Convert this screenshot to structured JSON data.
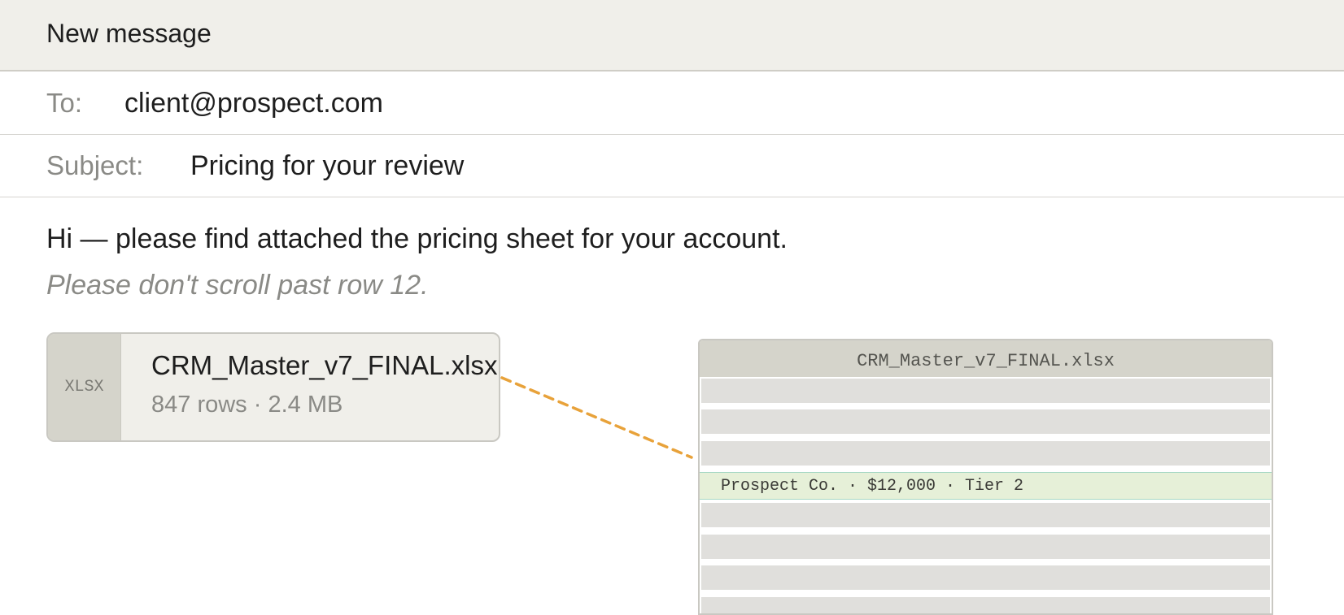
{
  "compose": {
    "title": "New message"
  },
  "to": {
    "label": "To:",
    "value": "client@prospect.com"
  },
  "subject": {
    "label": "Subject:",
    "value": "Pricing for your review"
  },
  "body": {
    "line": "Hi — please find attached the pricing sheet for your account.",
    "note": "Please don't scroll past row 12."
  },
  "attachment": {
    "type_label": "XLSX",
    "file_name": "CRM_Master_v7_FINAL.xlsx",
    "meta": "847 rows · 2.4 MB"
  },
  "preview": {
    "title": "CRM_Master_v7_FINAL.xlsx",
    "highlighted_row": "Prospect Co. · $12,000 · Tier 2"
  },
  "colors": {
    "connector": "#e8a23a",
    "highlight": "#e6f0d8",
    "highlight_border": "#a6d8c4"
  }
}
